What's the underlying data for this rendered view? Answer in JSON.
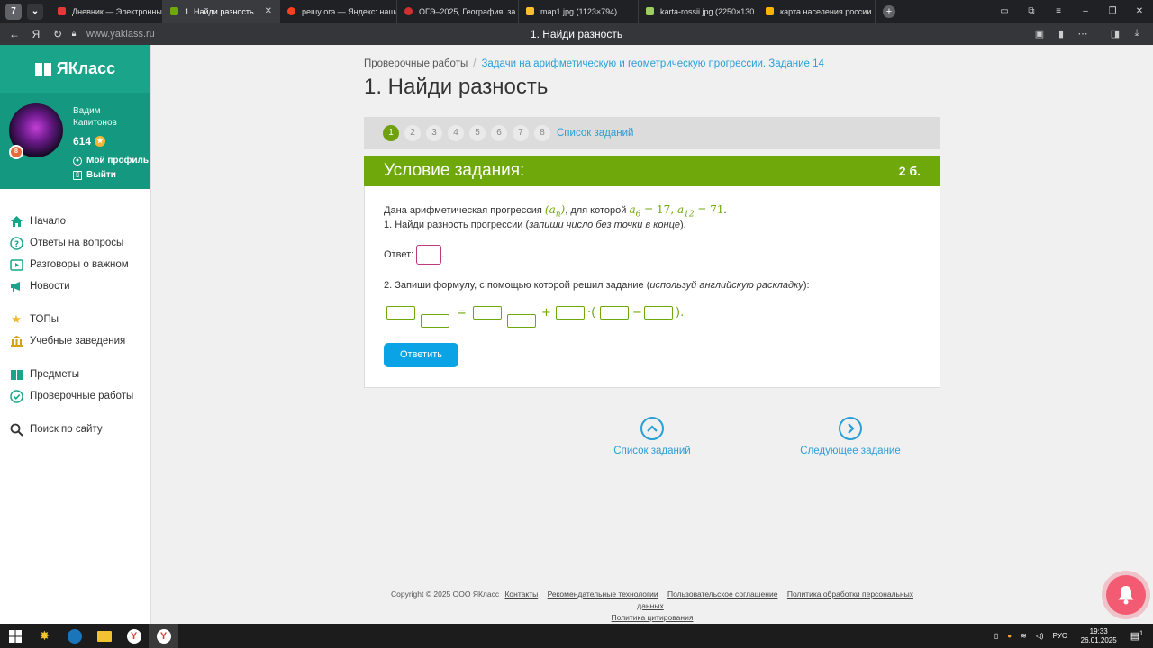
{
  "browser": {
    "tab_counter": "7",
    "tabs": [
      {
        "label": "Дневник — Электронный",
        "color": "#e53935",
        "active": false
      },
      {
        "label": "1. Найди разность",
        "color": "#6ea80b",
        "active": true
      },
      {
        "label": "решу огэ — Яндекс: нашл",
        "color": "#fc3f1d",
        "active": false
      },
      {
        "label": "ОГЭ–2025, География: за",
        "color": "#d32f2f",
        "active": false
      },
      {
        "label": "map1.jpg (1123×794)",
        "color": "#fbc02d",
        "active": false
      },
      {
        "label": "karta-rossii.jpg (2250×130",
        "color": "#9ccc65",
        "active": false
      },
      {
        "label": "карта населения россии",
        "color": "#ffb300",
        "active": false
      }
    ],
    "url": "www.yaklass.ru",
    "page_title": "1. Найди разность"
  },
  "sidebar": {
    "logo": "ЯКласс",
    "user_name_line1": "Вадим",
    "user_name_line2": "Капитонов",
    "points": "614",
    "level": "8",
    "profile_link": "Мой профиль",
    "logout_link": "Выйти",
    "menu": [
      {
        "label": "Начало",
        "icon": "home-icon"
      },
      {
        "label": "Ответы на вопросы",
        "icon": "question-icon"
      },
      {
        "label": "Разговоры о важном",
        "icon": "video-icon"
      },
      {
        "label": "Новости",
        "icon": "megaphone-icon"
      },
      {
        "label": "ТОПы",
        "icon": "star-icon"
      },
      {
        "label": "Учебные заведения",
        "icon": "school-icon"
      },
      {
        "label": "Предметы",
        "icon": "book-icon"
      },
      {
        "label": "Проверочные работы",
        "icon": "check-icon"
      },
      {
        "label": "Поиск по сайту",
        "icon": "search-icon"
      }
    ]
  },
  "main": {
    "breadcrumb_root": "Проверочные работы",
    "breadcrumb_sep": "/",
    "breadcrumb_link": "Задачи на арифметическую и геометрическую прогрессии. Задание 14",
    "title": "1. Найди разность",
    "steps": [
      "1",
      "2",
      "3",
      "4",
      "5",
      "6",
      "7",
      "8"
    ],
    "current_step": "1",
    "task_list_link": "Список заданий",
    "task_header": "Условие задания:",
    "task_points": "2 б.",
    "task_intro": "Дана арифметическая прогрессия",
    "task_intro_mid": ", для которой",
    "math_seq": "(a",
    "math_seq_sub": "n",
    "math_seq_end": ")",
    "math_a6": "a",
    "math_a6_sub": "6",
    "math_a6_val": " = 17, ",
    "math_a12": "a",
    "math_a12_sub": "12",
    "math_a12_val": " = 71",
    "math_end": ".",
    "q1_text": "1. Найди разность прогрессии (",
    "q1_em": "запиши число без точки в конце",
    "q1_end": ").",
    "answer_label": "Ответ:",
    "answer_dot": ".",
    "q2_text": "2. Запиши формулу, с помощью которой решил задание (",
    "q2_em": "используй английскую раскладку",
    "q2_end": "):",
    "formula_eq": "=",
    "formula_plus": "+",
    "formula_dot_paren": "·(",
    "formula_minus": "−",
    "formula_close": ").",
    "submit_button": "Ответить",
    "nav_list": "Список заданий",
    "nav_next": "Следующее задание"
  },
  "footer": {
    "copyright": "Copyright © 2025 ООО ЯКласс",
    "links": [
      "Контакты",
      "Рекомендательные технологии",
      "Пользовательское соглашение",
      "Политика обработки персональных данных"
    ],
    "citation": "Политика цитирования"
  },
  "taskbar": {
    "lang": "РУС",
    "time": "19:33",
    "date": "26.01.2025",
    "notif_count": "1"
  }
}
